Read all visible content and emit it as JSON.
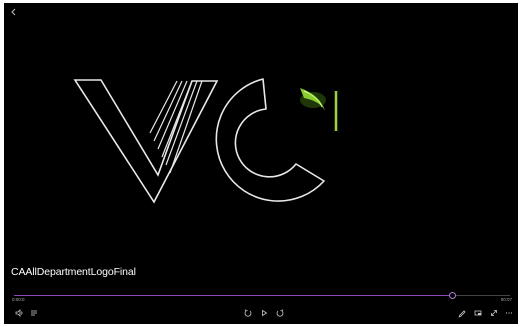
{
  "video": {
    "title": "CAAllDepartmentLogoFinal",
    "current_time": "0:00:0",
    "total_time": "00:07",
    "progress": 0.885
  },
  "logo": {
    "letters": "VC",
    "outline_color": "#e8e8e8",
    "accent_color": "#9be03a"
  },
  "colors": {
    "background": "#000000",
    "progress_color": "#8e47b8",
    "title_color": "#ffffff"
  },
  "icons": {
    "back": "back-arrow-icon",
    "volume": "volume-icon",
    "subtitles": "subtitles-icon",
    "skip_back": "skip-back-10-icon",
    "play": "play-icon",
    "skip_forward": "skip-forward-30-icon",
    "edit": "edit-pencil-icon",
    "mini_view": "mini-view-icon",
    "fullscreen": "fullscreen-icon",
    "more": "more-options-icon"
  }
}
